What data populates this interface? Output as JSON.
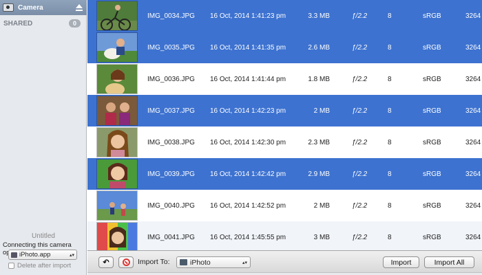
{
  "sidebar": {
    "device_label": "Camera",
    "shared_label": "SHARED",
    "shared_count": "0",
    "untitled": "Untitled",
    "connecting_label": "Connecting this camera opens:",
    "app_value": "iPhoto.app",
    "delete_after_import": "Delete after import"
  },
  "rows": [
    {
      "name": "IMG_0034.JPG",
      "date": "16 Oct, 2014 1:41:23 pm",
      "size": "3.3 MB",
      "aperture": "ƒ/2.2",
      "flash": "8",
      "space": "sRGB",
      "width": "3264",
      "selected": true
    },
    {
      "name": "IMG_0035.JPG",
      "date": "16 Oct, 2014 1:41:35 pm",
      "size": "2.6 MB",
      "aperture": "ƒ/2.2",
      "flash": "8",
      "space": "sRGB",
      "width": "3264",
      "selected": true
    },
    {
      "name": "IMG_0036.JPG",
      "date": "16 Oct, 2014 1:41:44 pm",
      "size": "1.8 MB",
      "aperture": "ƒ/2.2",
      "flash": "8",
      "space": "sRGB",
      "width": "3264",
      "selected": false
    },
    {
      "name": "IMG_0037.JPG",
      "date": "16 Oct, 2014 1:42:23 pm",
      "size": "2 MB",
      "aperture": "ƒ/2.2",
      "flash": "8",
      "space": "sRGB",
      "width": "3264",
      "selected": true
    },
    {
      "name": "IMG_0038.JPG",
      "date": "16 Oct, 2014 1:42:30 pm",
      "size": "2.3 MB",
      "aperture": "ƒ/2.2",
      "flash": "8",
      "space": "sRGB",
      "width": "3264",
      "selected": false
    },
    {
      "name": "IMG_0039.JPG",
      "date": "16 Oct, 2014 1:42:42 pm",
      "size": "2.9 MB",
      "aperture": "ƒ/2.2",
      "flash": "8",
      "space": "sRGB",
      "width": "3264",
      "selected": true
    },
    {
      "name": "IMG_0040.JPG",
      "date": "16 Oct, 2014 1:42:52 pm",
      "size": "2 MB",
      "aperture": "ƒ/2.2",
      "flash": "8",
      "space": "sRGB",
      "width": "3264",
      "selected": false
    },
    {
      "name": "IMG_0041.JPG",
      "date": "16 Oct, 2014 1:45:55 pm",
      "size": "3 MB",
      "aperture": "ƒ/2.2",
      "flash": "8",
      "space": "sRGB",
      "width": "3264",
      "selected": false
    }
  ],
  "toolbar": {
    "import_to_label": "Import To:",
    "destination": "iPhoto",
    "import_label": "Import",
    "import_all_label": "Import All"
  },
  "colors": {
    "selection": "#3d72d0",
    "sidebar_bg": "#e6e9ed"
  }
}
